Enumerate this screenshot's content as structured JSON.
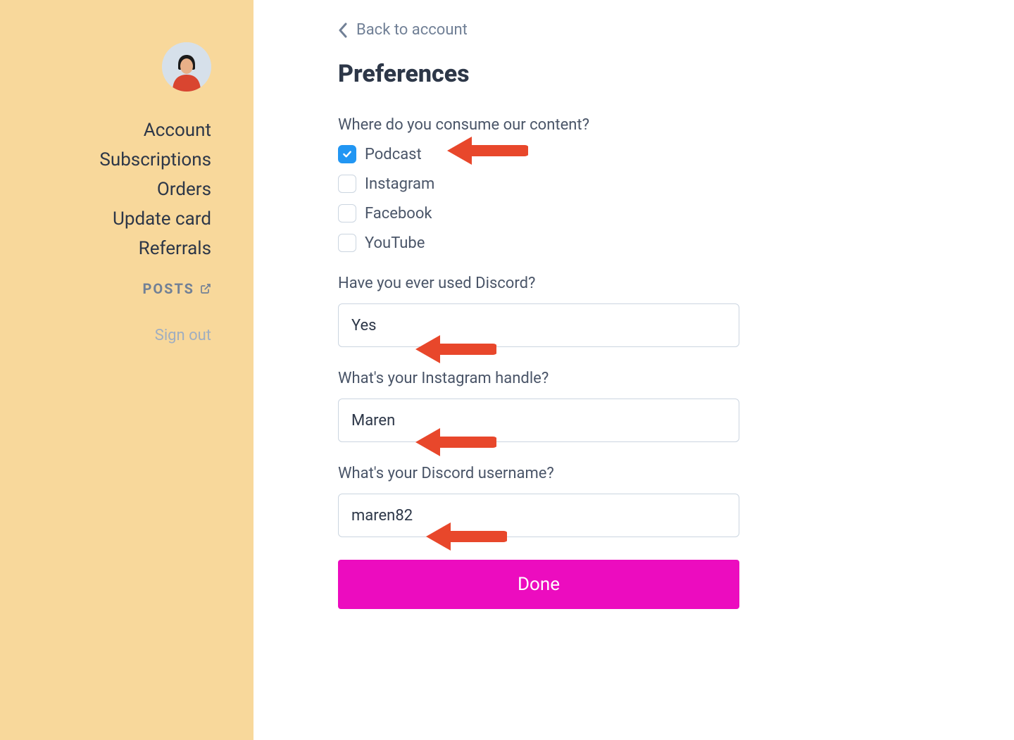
{
  "sidebar": {
    "nav_items": [
      "Account",
      "Subscriptions",
      "Orders",
      "Update card",
      "Referrals"
    ],
    "posts_label": "POSTS",
    "sign_out_label": "Sign out"
  },
  "main": {
    "back_label": "Back to account",
    "title": "Preferences",
    "question_consume": "Where do you consume our content?",
    "consume_options": [
      {
        "label": "Podcast",
        "checked": true
      },
      {
        "label": "Instagram",
        "checked": false
      },
      {
        "label": "Facebook",
        "checked": false
      },
      {
        "label": "YouTube",
        "checked": false
      }
    ],
    "question_discord_used": "Have you ever used Discord?",
    "discord_used_value": "Yes",
    "question_instagram": "What's your Instagram handle?",
    "instagram_value": "Maren",
    "question_discord_name": "What's your Discord username?",
    "discord_name_value": "maren82",
    "done_label": "Done"
  },
  "colors": {
    "sidebar_bg": "#F8D89B",
    "primary_button": "#EC0CBF",
    "checkbox_checked": "#2196F3",
    "annotation_arrow": "#E8472B"
  }
}
